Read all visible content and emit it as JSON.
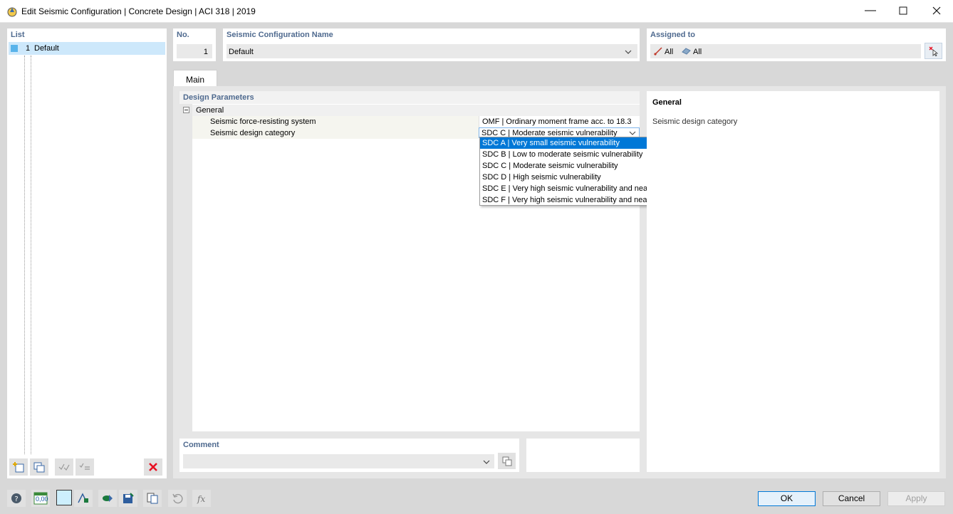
{
  "window": {
    "title": "Edit Seismic Configuration | Concrete Design | ACI 318 | 2019"
  },
  "list": {
    "heading": "List",
    "items": [
      {
        "number": "1",
        "label": "Default",
        "color": "#59b3ea"
      }
    ]
  },
  "number_field": {
    "heading": "No.",
    "value": "1"
  },
  "name_field": {
    "heading": "Seismic Configuration Name",
    "value": "Default"
  },
  "assigned": {
    "heading": "Assigned to",
    "members_label": "All",
    "surfaces_label": "All"
  },
  "tabs": [
    {
      "label": "Main",
      "active": true
    }
  ],
  "design_parameters": {
    "heading": "Design Parameters",
    "group_label": "General",
    "rows": [
      {
        "label": "Seismic force-resisting system",
        "value": "OMF | Ordinary moment frame acc. to 18.3"
      },
      {
        "label": "Seismic design category",
        "value": "SDC C | Moderate seismic vulnerability"
      }
    ]
  },
  "dropdown": {
    "options": [
      "SDC A | Very small seismic vulnerability",
      "SDC B | Low to moderate seismic vulnerability",
      "SDC C | Moderate seismic vulnerability",
      "SDC D | High seismic vulnerability",
      "SDC E | Very high seismic vulnerability and near a major fault",
      "SDC F | Very high seismic vulnerability and near a major fault"
    ],
    "highlighted_index": 0
  },
  "info_panel": {
    "heading": "General",
    "text": "Seismic design category"
  },
  "comment": {
    "heading": "Comment",
    "value": ""
  },
  "buttons": {
    "ok": "OK",
    "cancel": "Cancel",
    "apply": "Apply"
  },
  "icons": {
    "units_label": "0,00"
  },
  "colors": {
    "accent": "#0078d7",
    "section_label": "#4f6a8f",
    "selection": "#cde8fb",
    "delete_red": "#e81123"
  }
}
